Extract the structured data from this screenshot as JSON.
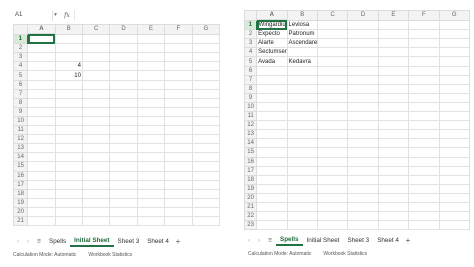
{
  "left": {
    "namebox": "A1",
    "fx": "fx",
    "columns": [
      "A",
      "B",
      "C",
      "D",
      "E",
      "F",
      "G"
    ],
    "rows": [
      "1",
      "2",
      "3",
      "4",
      "5",
      "6",
      "7",
      "8",
      "9",
      "10",
      "11",
      "12",
      "13",
      "14",
      "15",
      "16",
      "17",
      "18",
      "19",
      "20",
      "21"
    ],
    "cells": {
      "B4": "4",
      "B5": "10"
    },
    "tabs": [
      "Spells",
      "Initial Sheet",
      "Sheet 3",
      "Sheet 4"
    ],
    "active_tab": "Initial Sheet",
    "status": [
      "Calculation Mode: Automatic",
      "Workbook Statistics"
    ]
  },
  "right": {
    "columns": [
      "A",
      "B",
      "C",
      "D",
      "E",
      "F",
      "G"
    ],
    "rows": [
      "1",
      "2",
      "3",
      "4",
      "5",
      "6",
      "7",
      "8",
      "9",
      "10",
      "11",
      "12",
      "13",
      "14",
      "15",
      "16",
      "17",
      "18",
      "19",
      "20",
      "21",
      "22",
      "23"
    ],
    "cells": {
      "A1": "Wingardiu",
      "B1": "Leviosa",
      "A2": "Expecto",
      "B2": "Patronum",
      "A3": "Alarte",
      "B3": "Ascendare",
      "A4": "Sectumsempra",
      "A5": "Avada",
      "B5": "Kedavra"
    },
    "tabs": [
      "Spells",
      "Initial Sheet",
      "Sheet 3",
      "Sheet 4"
    ],
    "active_tab": "Spells",
    "status": [
      "Calculation Mode: Automatic",
      "Workbook Statistics"
    ]
  }
}
